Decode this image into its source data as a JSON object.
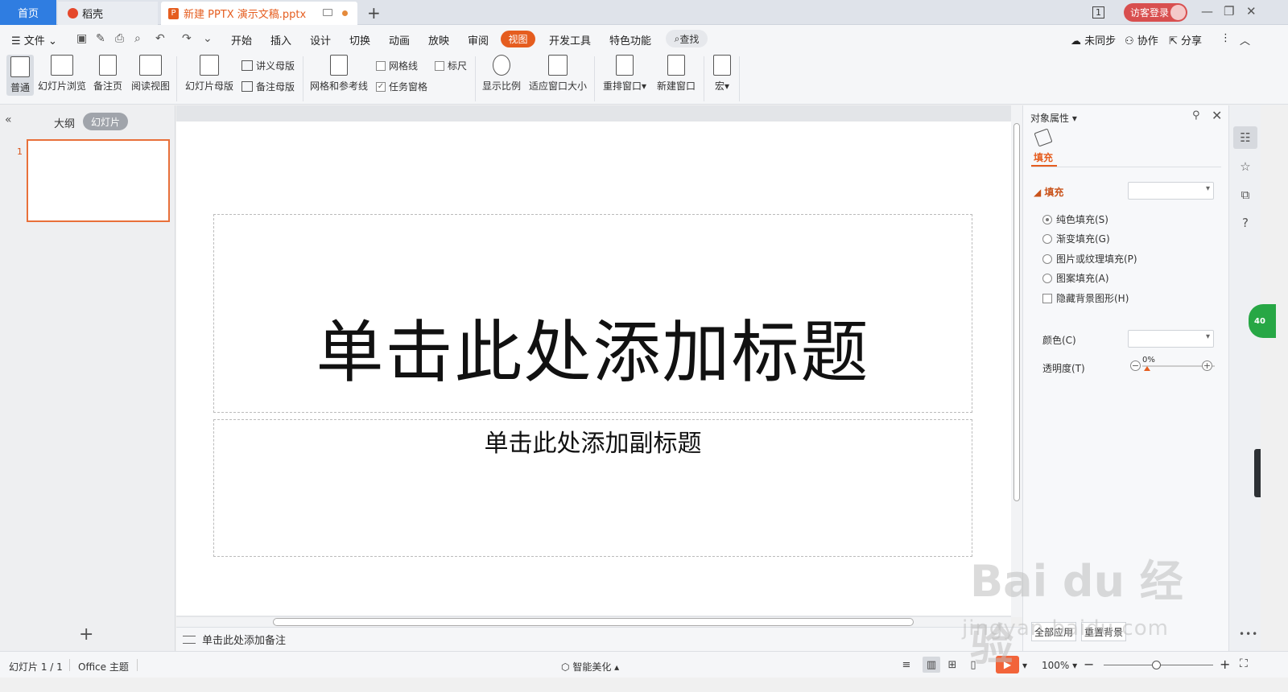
{
  "tabs": {
    "home": "首页",
    "docer": "稻壳",
    "document": "新建 PPTX 演示文稿.pptx"
  },
  "titlebar": {
    "window_count": "1",
    "login": "访客登录"
  },
  "menu": {
    "file": "文件",
    "items": [
      "开始",
      "插入",
      "设计",
      "切换",
      "动画",
      "放映",
      "审阅",
      "视图",
      "开发工具",
      "特色功能"
    ],
    "active": "视图",
    "search": "查找",
    "unsynced": "未同步",
    "collab": "协作",
    "share": "分享"
  },
  "ribbon": {
    "normal": "普通",
    "slide_sorter": "幻灯片浏览",
    "notes_page": "备注页",
    "reading_view": "阅读视图",
    "slide_master": "幻灯片母版",
    "handout_master": "讲义母版",
    "notes_master": "备注母版",
    "grid_guides": "网格和参考线",
    "gridlines": "网格线",
    "ruler": "标尺",
    "task_pane": "任务窗格",
    "zoom": "显示比例",
    "fit_window": "适应窗口大小",
    "arrange": "重排窗口",
    "new_window": "新建窗口",
    "macro": "宏"
  },
  "left_panel": {
    "outline": "大纲",
    "slides": "幻灯片",
    "slide_number": "1"
  },
  "slide": {
    "title_placeholder": "单击此处添加标题",
    "subtitle_placeholder": "单击此处添加副标题"
  },
  "notes": {
    "placeholder": "单击此处添加备注"
  },
  "right_panel": {
    "title": "对象属性",
    "fill_tab": "填充",
    "fill_section": "填充",
    "options": [
      "纯色填充(S)",
      "渐变填充(G)",
      "图片或纹理填充(P)",
      "图案填充(A)"
    ],
    "hide_bg": "隐藏背景图形(H)",
    "color_label": "颜色(C)",
    "transparency_label": "透明度(T)",
    "transparency_value": "0%",
    "apply_all": "全部应用",
    "reset": "重置背景"
  },
  "side_rail": {
    "badge": "40"
  },
  "status": {
    "slide_count": "幻灯片 1 / 1",
    "theme": "Office 主题",
    "smart_beautify": "智能美化",
    "zoom_value": "100%"
  },
  "watermark": {
    "main": "Bai du 经验",
    "sub": "jingyan.baidu.com"
  }
}
